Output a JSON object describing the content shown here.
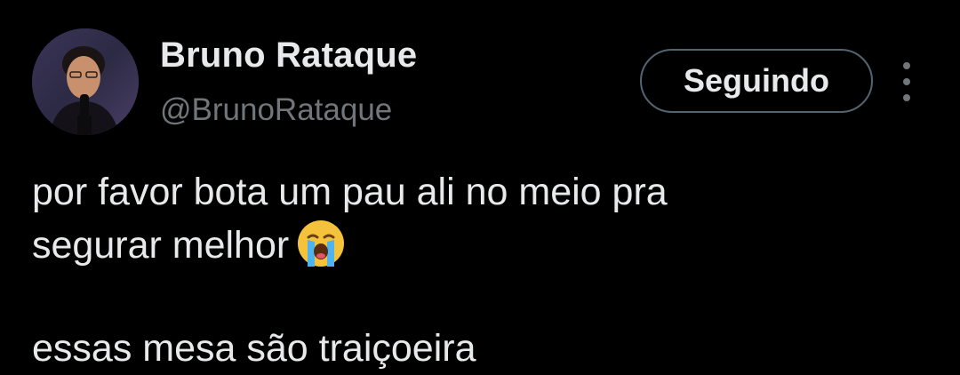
{
  "author": {
    "display_name": "Bruno Rataque",
    "handle": "@BrunoRataque"
  },
  "follow_button": {
    "label": "Seguindo"
  },
  "more_button": {
    "icon": "more-vertical-icon"
  },
  "tweet": {
    "line1": "por favor bota um pau ali no meio pra",
    "line2": "segurar melhor",
    "emoji": "loudly-crying-face-icon",
    "next_line_partial": "essas mesa são traiçoeira"
  },
  "colors": {
    "background": "#000000",
    "primary_text": "#e7e9ea",
    "secondary_text": "#71767b",
    "button_border": "#536471"
  }
}
